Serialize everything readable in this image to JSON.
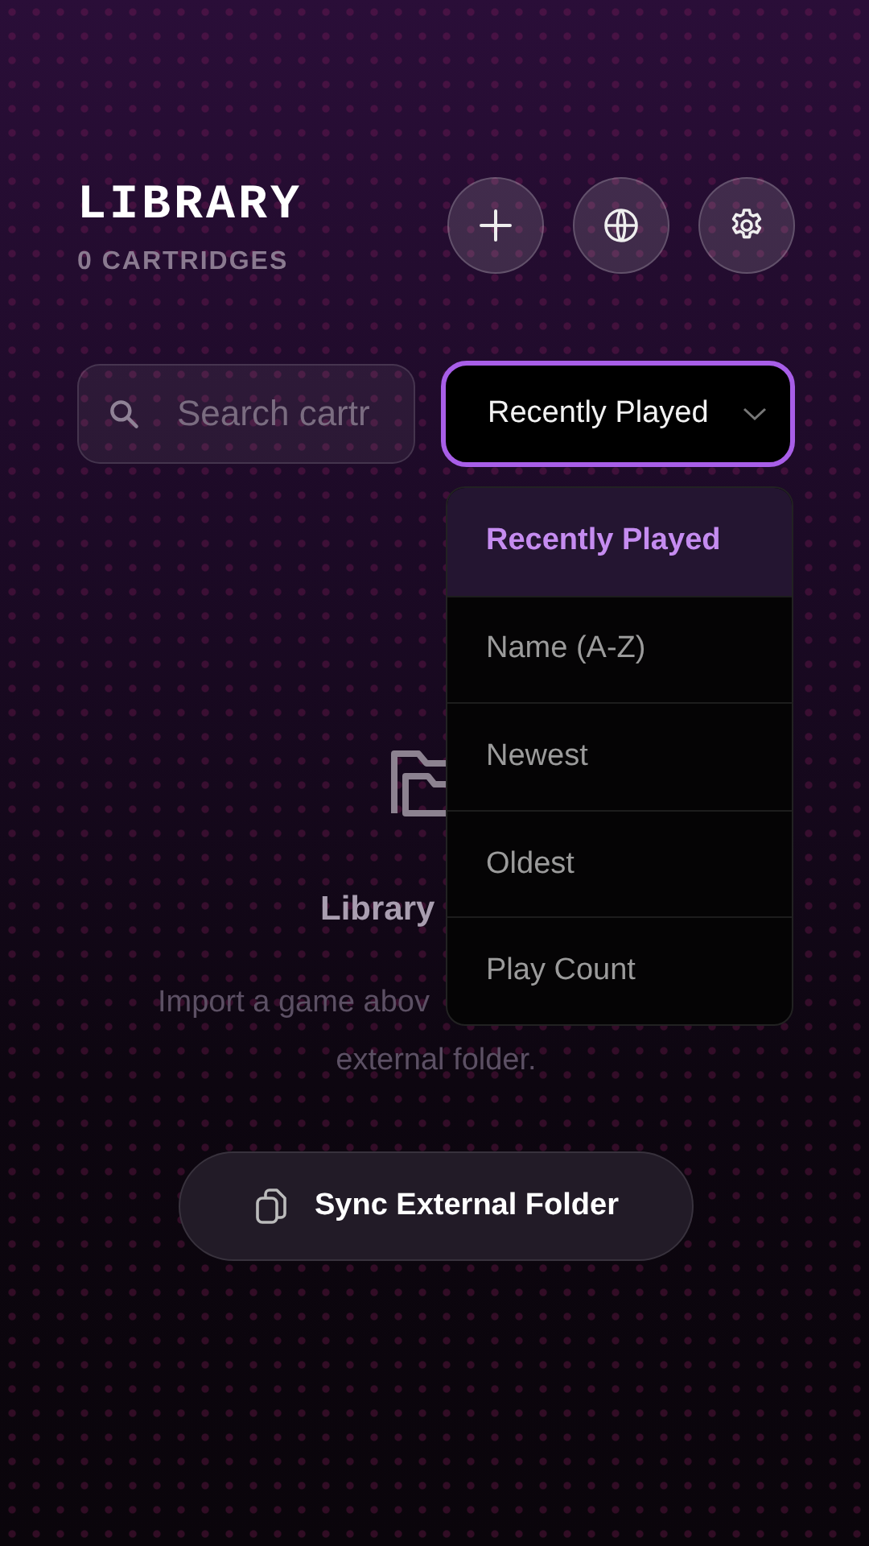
{
  "header": {
    "title": "LIBRARY",
    "subtitle": "0 CARTRIDGES"
  },
  "search": {
    "placeholder": "Search cartr"
  },
  "sort_select": {
    "value": "Recently Played",
    "expanded": true
  },
  "sort_options": [
    {
      "label": "Recently Played",
      "selected": true
    },
    {
      "label": "Name (A-Z)",
      "selected": false
    },
    {
      "label": "Newest",
      "selected": false
    },
    {
      "label": "Oldest",
      "selected": false
    },
    {
      "label": "Play Count",
      "selected": false
    }
  ],
  "empty_state": {
    "title": "Library",
    "message_lines": [
      "Import a game abov",
      "external folder."
    ],
    "button": "Sync External Folder"
  }
}
